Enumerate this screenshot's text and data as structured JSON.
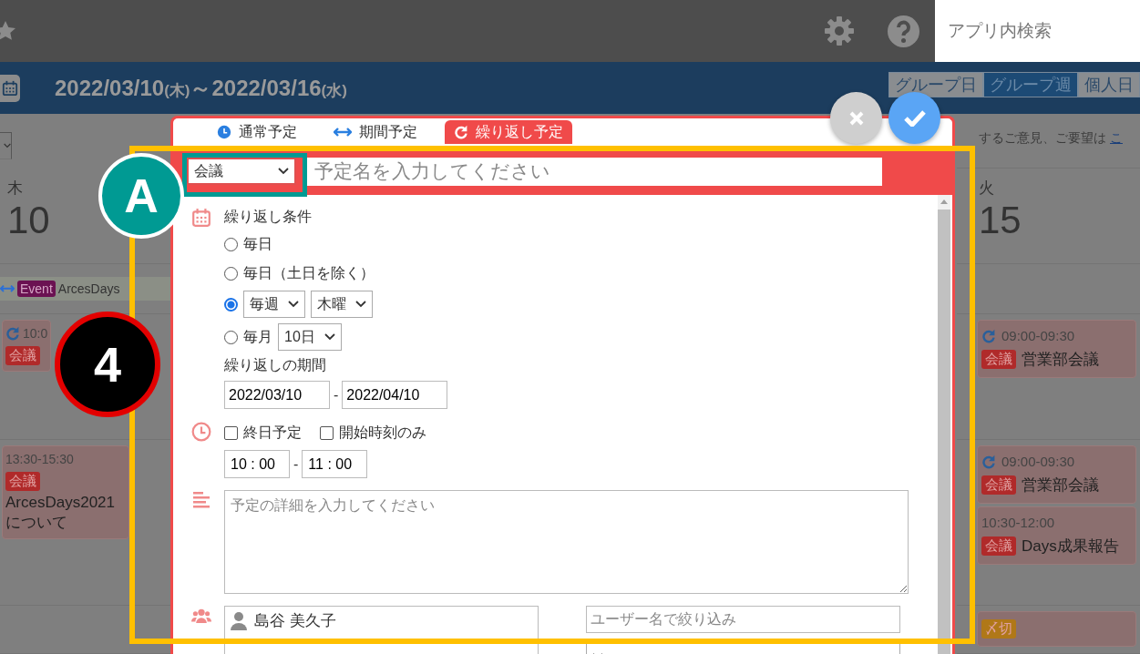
{
  "topbar": {
    "search": {
      "placeholder": "アプリ内検索"
    }
  },
  "header": {
    "date_range": {
      "start": "2022/03/10",
      "start_weekday": "(木)",
      "separator": "～",
      "end": "2022/03/16",
      "end_weekday": "(水)"
    },
    "view_tabs": [
      {
        "label": "グループ日",
        "selected": false
      },
      {
        "label": "グループ週",
        "selected": true
      },
      {
        "label": "個人日",
        "selected": false
      }
    ]
  },
  "notice": {
    "text": "するご意見、ご要望は",
    "link": "こ"
  },
  "days": [
    {
      "weekday": "木",
      "date": "10",
      "all_day": [
        {
          "tag": "Event",
          "color": "#6b1252",
          "title": "ArcesDays"
        }
      ],
      "rows": [
        [
          {
            "repeat": true,
            "time": "10:0",
            "tag": "会議",
            "color": "#b02a2a"
          }
        ],
        [
          {
            "repeat": false,
            "time": "13:30-15:30",
            "tag": "会議",
            "color": "#b02a2a",
            "title": "ArcesDays2021について"
          }
        ],
        []
      ]
    },
    {
      "weekday": "火",
      "date": "15",
      "rows": [
        [
          {
            "repeat": true,
            "time": "09:00-09:30",
            "tag": "会議",
            "color": "#b02a2a",
            "title": "営業部会議"
          }
        ],
        [
          {
            "repeat": true,
            "time": "09:00-09:30",
            "tag": "会議",
            "color": "#b02a2a",
            "title": "営業部会議"
          },
          {
            "repeat": false,
            "time": "10:30-12:00",
            "tag": "会議",
            "color": "#b02a2a",
            "title": "Days成果報告"
          }
        ],
        [
          {
            "repeat": false,
            "tag": "〆切",
            "color": "#b07818"
          }
        ]
      ]
    }
  ],
  "dialog": {
    "tabs": [
      {
        "kind": "single",
        "label": "通常予定",
        "selected": false
      },
      {
        "kind": "period",
        "label": "期間予定",
        "selected": false
      },
      {
        "kind": "repeat",
        "label": "繰り返し予定",
        "selected": true
      }
    ],
    "category": "会議",
    "title": {
      "placeholder": "予定名を入力してください"
    },
    "repeat_label": "繰り返し条件",
    "repeat_options": [
      {
        "label": "毎日",
        "selected": false
      },
      {
        "label": "毎日（土日を除く）",
        "selected": false
      },
      {
        "selects": [
          "毎週",
          "木曜"
        ],
        "selected": true
      },
      {
        "label": "毎月",
        "selects": [
          "10日"
        ],
        "selected": false
      }
    ],
    "period_label": "繰り返しの期間",
    "period": {
      "from": "2022/03/10",
      "separator": "-",
      "to": "2022/04/10"
    },
    "time_options": [
      {
        "label": "終日予定",
        "checked": false
      },
      {
        "label": "開始時刻のみ",
        "checked": false
      }
    ],
    "time": {
      "from": "10 : 00",
      "separator": "-",
      "to": "11 : 00"
    },
    "detail": {
      "placeholder": "予定の詳細を入力してください"
    },
    "members": [
      "島谷 美久子"
    ],
    "member_filter": {
      "placeholder": "ユーザー名で絞り込み"
    }
  },
  "callouts": [
    {
      "kind": "letter",
      "text": "A"
    },
    {
      "kind": "step",
      "text": "4"
    }
  ]
}
